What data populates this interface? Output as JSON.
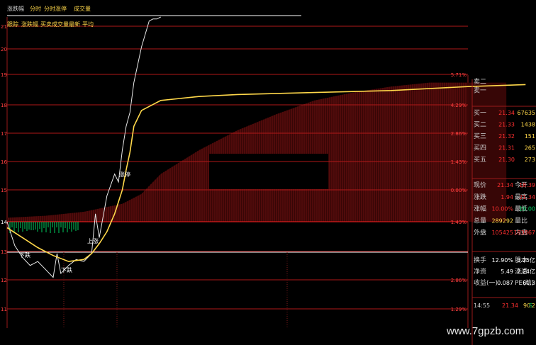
{
  "header": {
    "title": "涨跌幅",
    "tabs": [
      "分时",
      "分时涨停",
      "成交量"
    ],
    "sub_tabs": [
      "跟踪",
      "涨跌幅",
      "买卖",
      "成交量",
      "最新",
      "平均"
    ]
  },
  "chart_data": {
    "type": "line",
    "title": "",
    "left_ticks": [
      "21",
      "20",
      "19",
      "18",
      "17",
      "16",
      "15",
      "14",
      "13",
      "12",
      "11"
    ],
    "right_ticks": [
      "",
      "",
      "5.71%",
      "4.29%",
      "2.86%",
      "1.43%",
      "0.00%",
      "1.43%",
      "",
      "2.86%",
      "1.29%"
    ],
    "annotations": {
      "low_1": "下跌",
      "low_2": "下跌",
      "mark_1": "上涨",
      "mark_2": "涨停"
    },
    "series": [
      {
        "name": "price",
        "color": "#e8e8e8",
        "x": [
          0,
          4,
          8,
          12,
          16,
          20,
          24,
          26,
          28,
          32,
          36,
          40,
          44,
          46,
          48,
          52,
          56,
          58,
          60,
          62,
          64,
          66,
          70,
          74,
          76,
          78,
          80
        ],
        "y": [
          0.0,
          -1.2,
          -1.8,
          -2.2,
          -2.0,
          -2.4,
          -2.8,
          -1.6,
          -2.6,
          -2.2,
          -1.9,
          -2.0,
          -1.6,
          0.4,
          -0.8,
          1.3,
          2.4,
          2.0,
          3.6,
          4.8,
          5.5,
          7.0,
          8.8,
          10.1,
          10.2,
          10.2,
          10.3
        ]
      },
      {
        "name": "average",
        "color": "#ffd84a",
        "x": [
          0,
          8,
          16,
          24,
          32,
          40,
          44,
          48,
          52,
          56,
          60,
          62,
          64,
          66,
          70,
          80,
          100,
          120,
          160,
          200,
          240,
          270
        ],
        "y": [
          -0.3,
          -0.8,
          -1.3,
          -1.7,
          -2.0,
          -1.9,
          -1.6,
          -1.1,
          -0.5,
          0.4,
          1.6,
          2.6,
          3.5,
          4.8,
          5.6,
          6.1,
          6.3,
          6.4,
          6.5,
          6.6,
          6.8,
          6.9
        ]
      }
    ],
    "volume": {
      "x": [
        0,
        20,
        40,
        60,
        70,
        80,
        100,
        120,
        140,
        160,
        180,
        200,
        220,
        240,
        260
      ],
      "y": [
        0.2,
        0.3,
        0.5,
        0.9,
        1.4,
        2.4,
        3.6,
        4.6,
        5.4,
        6.1,
        6.5,
        6.8,
        7.0,
        7.0,
        7.0
      ]
    }
  },
  "order_book": {
    "sell": [
      {
        "label": "卖二",
        "price": "",
        "volume": ""
      },
      {
        "label": "卖一",
        "price": "",
        "volume": ""
      }
    ],
    "buy": [
      {
        "label": "买一",
        "price": "21.34",
        "volume": "67635"
      },
      {
        "label": "买二",
        "price": "21.33",
        "volume": "1438"
      },
      {
        "label": "买三",
        "price": "21.32",
        "volume": "151"
      },
      {
        "label": "买四",
        "price": "21.31",
        "volume": "265"
      },
      {
        "label": "买五",
        "price": "21.30",
        "volume": "273"
      }
    ]
  },
  "quote": [
    {
      "l1": "现价",
      "v1": "21.34",
      "l2": "今开",
      "v2": "18.39"
    },
    {
      "l1": "涨跌",
      "v1": "1.94",
      "l2": "最高",
      "v2": "21.34"
    },
    {
      "l1": "涨幅",
      "v1": "10.00%",
      "l2": "最低",
      "v2": "19.00"
    },
    {
      "l1": "总量",
      "v1": "289292",
      "l2": "量比",
      "v2": ""
    },
    {
      "l1": "外盘",
      "v1": "105425",
      "l2": "内盘",
      "v2": "183867"
    }
  ],
  "fundamentals": [
    {
      "l1": "换手",
      "v1": "12.90%",
      "l2": "股本",
      "v2": "3.25亿"
    },
    {
      "l1": "净资",
      "v1": "5.49",
      "l2": "流通",
      "v2": "2.24亿"
    },
    {
      "l1": "收益(一)",
      "v1": "0.087",
      "l2": "PE(动)",
      "v2": "61.3"
    }
  ],
  "last_tick": {
    "time": "14:55",
    "price": "21.34",
    "volume": "90",
    "flag": "S",
    "extra": "2"
  },
  "watermark": "www.7gpzb.com",
  "colors": {
    "up": "#ff3030",
    "down": "#00d060",
    "avg": "#ffd84a",
    "grid": "#b01818",
    "price_line": "#e8e8e8"
  }
}
